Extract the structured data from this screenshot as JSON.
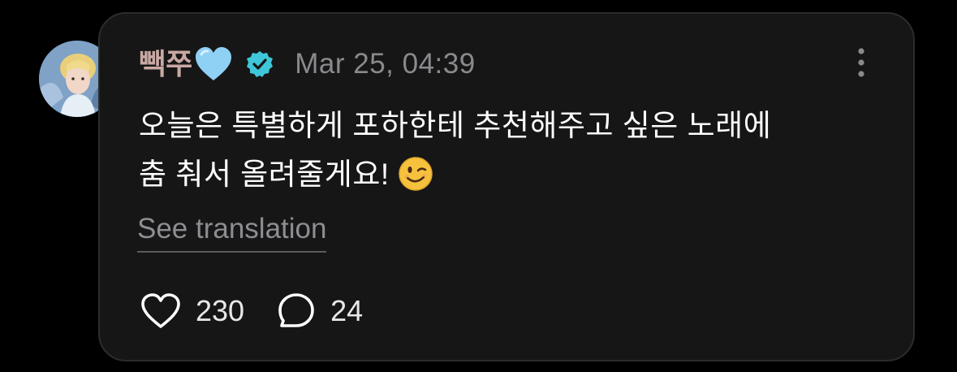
{
  "post": {
    "username": "빽쭈",
    "name_emoji": "light-blue-heart",
    "verified_icon": "verified-badge-icon",
    "timestamp": "Mar 25, 04:39",
    "body_line_1": "오늘은 특별하게 포하한테 추천해주고 싶은 노래에",
    "body_line_2": "춤 춰서 올려줄게요!",
    "body_emoji": "winking-face",
    "see_translation": "See translation",
    "likes": "230",
    "replies": "24"
  },
  "colors": {
    "background": "#000000",
    "card": "#161616",
    "username": "#c9a8a3",
    "verified": "#3fc7d9",
    "heart_emoji": "#8fd0f5",
    "muted_text": "#8a8a8e"
  }
}
